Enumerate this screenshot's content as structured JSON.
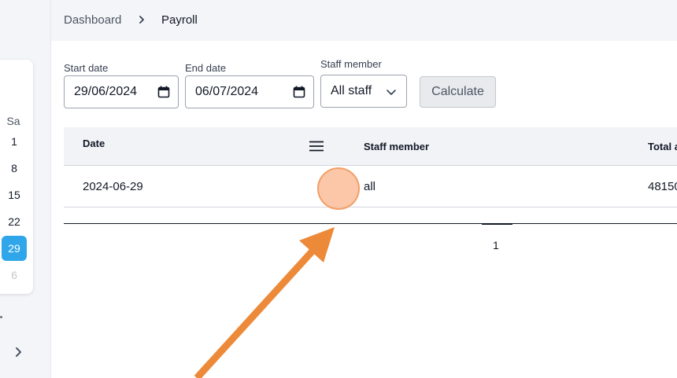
{
  "breadcrumb": {
    "home": "Dashboard",
    "current": "Payroll"
  },
  "calendar": {
    "weekday_header": "Sa",
    "days": [
      "1",
      "8",
      "15",
      "22",
      "29",
      "6"
    ],
    "selected_day": "29"
  },
  "filters": {
    "start_label": "Start date",
    "start_value": "29/06/2024",
    "end_label": "End date",
    "end_value": "06/07/2024",
    "staff_label": "Staff member",
    "staff_value": "All staff",
    "calculate_label": "Calculate"
  },
  "table": {
    "columns": [
      "Date",
      "Staff member",
      "Total a"
    ],
    "rows": [
      {
        "date": "2024-06-29",
        "staff": "all",
        "total": "48150"
      }
    ]
  },
  "pagination": {
    "current_page": "1"
  },
  "colors": {
    "selected_day": "#2fa6ea",
    "annotation": "#ec8a3a"
  }
}
